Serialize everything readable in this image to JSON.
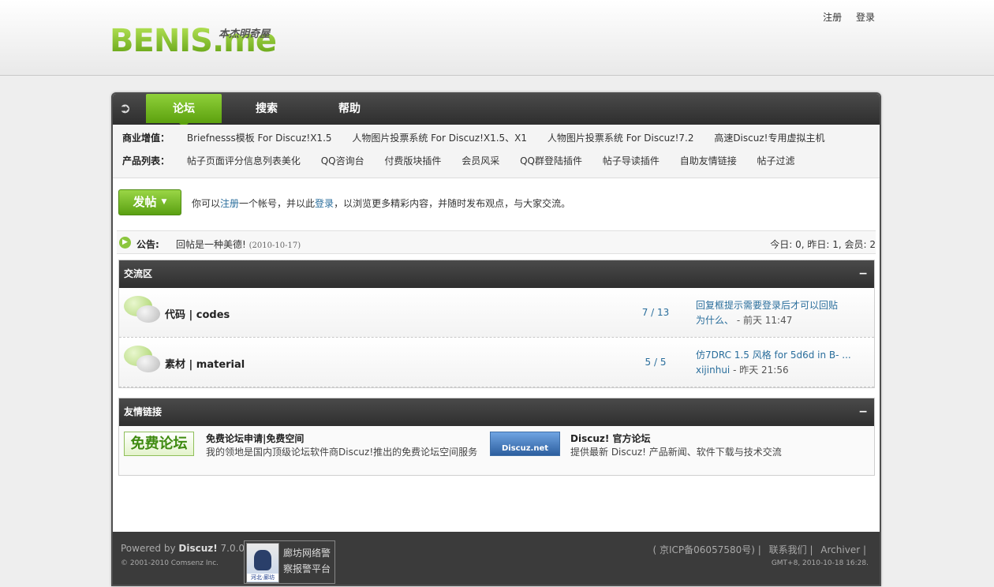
{
  "logo": {
    "main": "BENIS.me",
    "subtitle": "本杰明奇屋"
  },
  "user_links": {
    "register": "注册",
    "login": "登录"
  },
  "nav": {
    "home_icon": "home-arrow-icon",
    "items": [
      {
        "label": "论坛",
        "active": true
      },
      {
        "label": "搜索",
        "active": false
      },
      {
        "label": "帮助",
        "active": false
      }
    ]
  },
  "subnav": {
    "commercial_label": "商业增值：",
    "commercial_items": [
      "Briefnesss模板 For Discuz!X1.5",
      "人物图片投票系统 For Discuz!X1.5、X1",
      "人物图片投票系统 For Discuz!7.2",
      "高速Discuz!专用虚拟主机"
    ],
    "products_label": "产品列表：",
    "products_items": [
      "帖子页面评分信息列表美化",
      "QQ咨询台",
      "付费版块插件",
      "会员风采",
      "QQ群登陆插件",
      "帖子导读插件",
      "自助友情链接",
      "帖子过滤"
    ]
  },
  "post_button": {
    "label": "发帖",
    "caret": "▼"
  },
  "welcome": {
    "prefix": "你可以",
    "register": "注册",
    "mid": "一个帐号，并以此",
    "login": "登录",
    "suffix": "，以浏览更多精彩内容，并随时发布观点，与大家交流。"
  },
  "notice": {
    "label": "公告:",
    "text": "回帖是一种美德!",
    "date": "(2010-10-17)",
    "stats": "今日: 0, 昨日: 1, 会员: 2"
  },
  "category": {
    "title": "交流区",
    "collapse": "−",
    "forums": [
      {
        "name": "代码 | codes",
        "threads": "7",
        "posts": "13",
        "last_title_line1": "回复框提示需要登录后才可以回贴",
        "last_title_line2": "为什么、",
        "last_meta": " - 前天 11:47"
      },
      {
        "name": "素材 | material",
        "threads": "5",
        "posts": "5",
        "last_title_line1": "仿7DRC 1.5 风格 for 5d6d in B- ...",
        "last_title_line2": "xijinhui",
        "last_meta": " - 昨天 21:56"
      }
    ]
  },
  "links": {
    "title": "友情链接",
    "collapse": "−",
    "items": [
      {
        "logo_text": "免费论坛",
        "title": "免费论坛申请|免费空间",
        "desc": "我的领地是国内顶级论坛软件商Discuz!推出的免费论坛空间服务"
      },
      {
        "logo_text": "Discuz.net",
        "title": "Discuz! 官方论坛",
        "desc": "提供最新 Discuz! 产品新闻、软件下载与技术交流"
      }
    ]
  },
  "footer": {
    "powered_prefix": "Powered by ",
    "powered_brand": "Discuz!",
    "powered_version": " 7.0.0",
    "copyright": "© 2001-2010 Comsenz Inc.",
    "police_caption": "河北·廊坊",
    "police_line1": "廊坊网络警",
    "police_line2": "察报警平台",
    "icp": "( 京ICP备06057580号)",
    "contact": "联系我们",
    "archiver": "Archiver",
    "time": "GMT+8, 2010-10-18 16:28."
  },
  "colors": {
    "accent_green": "#6cb11f",
    "header_dark": "#3a3a3a",
    "link_blue": "#2a6e9c"
  }
}
